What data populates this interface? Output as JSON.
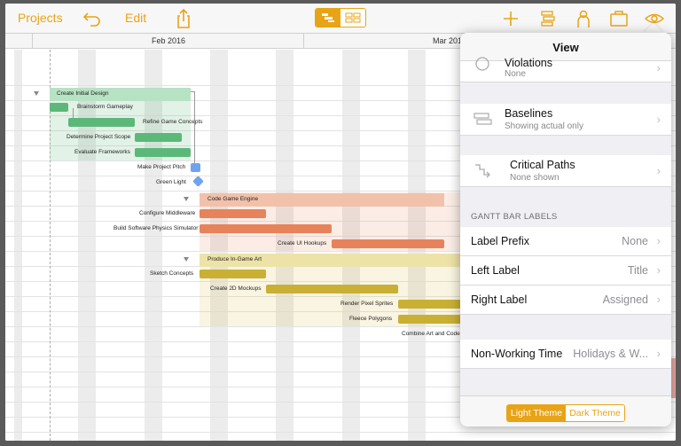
{
  "toolbar": {
    "projects_label": "Projects",
    "edit_label": "Edit",
    "icons": [
      "undo-icon",
      "share-icon",
      "gantt-view-icon",
      "grid-view-icon",
      "add-icon",
      "alignment-icon",
      "resource-icon",
      "inspector-icon",
      "view-eye-icon"
    ],
    "accent_color": "#e8a416"
  },
  "timeline": {
    "months": [
      "Feb 2016",
      "Mar 201"
    ]
  },
  "gantt": {
    "groups": [
      {
        "name": "Create Initial Design",
        "color": "#5cb879"
      },
      {
        "name": "Code Game Engine",
        "color": "#e6835a"
      },
      {
        "name": "Produce In-Game Art",
        "color": "#d4bd3c"
      }
    ],
    "tasks": [
      "Brainstorm Gameplay",
      "Refine Game Concepts",
      "Determine Project Scope",
      "Evaluate Frameworks",
      "Make Project Pitch",
      "Green Light",
      "Configure Middleware",
      "Build Software Physics Simulator",
      "Create UI Hookups",
      "Sketch Concepts",
      "Create 2D Mockups",
      "Render Pixel Sprites",
      "Fleece Polygons",
      "Combine Art and Code"
    ]
  },
  "view_popover": {
    "title": "View",
    "rows": [
      {
        "title": "Violations",
        "subtitle": "None",
        "icon": "violations-icon"
      },
      {
        "title": "Baselines",
        "subtitle": "Showing actual only",
        "icon": "baselines-icon"
      },
      {
        "title": "Critical Paths",
        "subtitle": "None shown",
        "icon": "critical-paths-icon"
      }
    ],
    "section_header": "GANTT BAR LABELS",
    "label_rows": [
      {
        "title": "Label Prefix",
        "value": "None"
      },
      {
        "title": "Left Label",
        "value": "Title"
      },
      {
        "title": "Right Label",
        "value": "Assigned"
      }
    ],
    "non_working": {
      "title": "Non-Working Time",
      "value": "Holidays & W..."
    },
    "theme": {
      "light": "Light Theme",
      "dark": "Dark Theme",
      "selected": "Light Theme"
    }
  }
}
